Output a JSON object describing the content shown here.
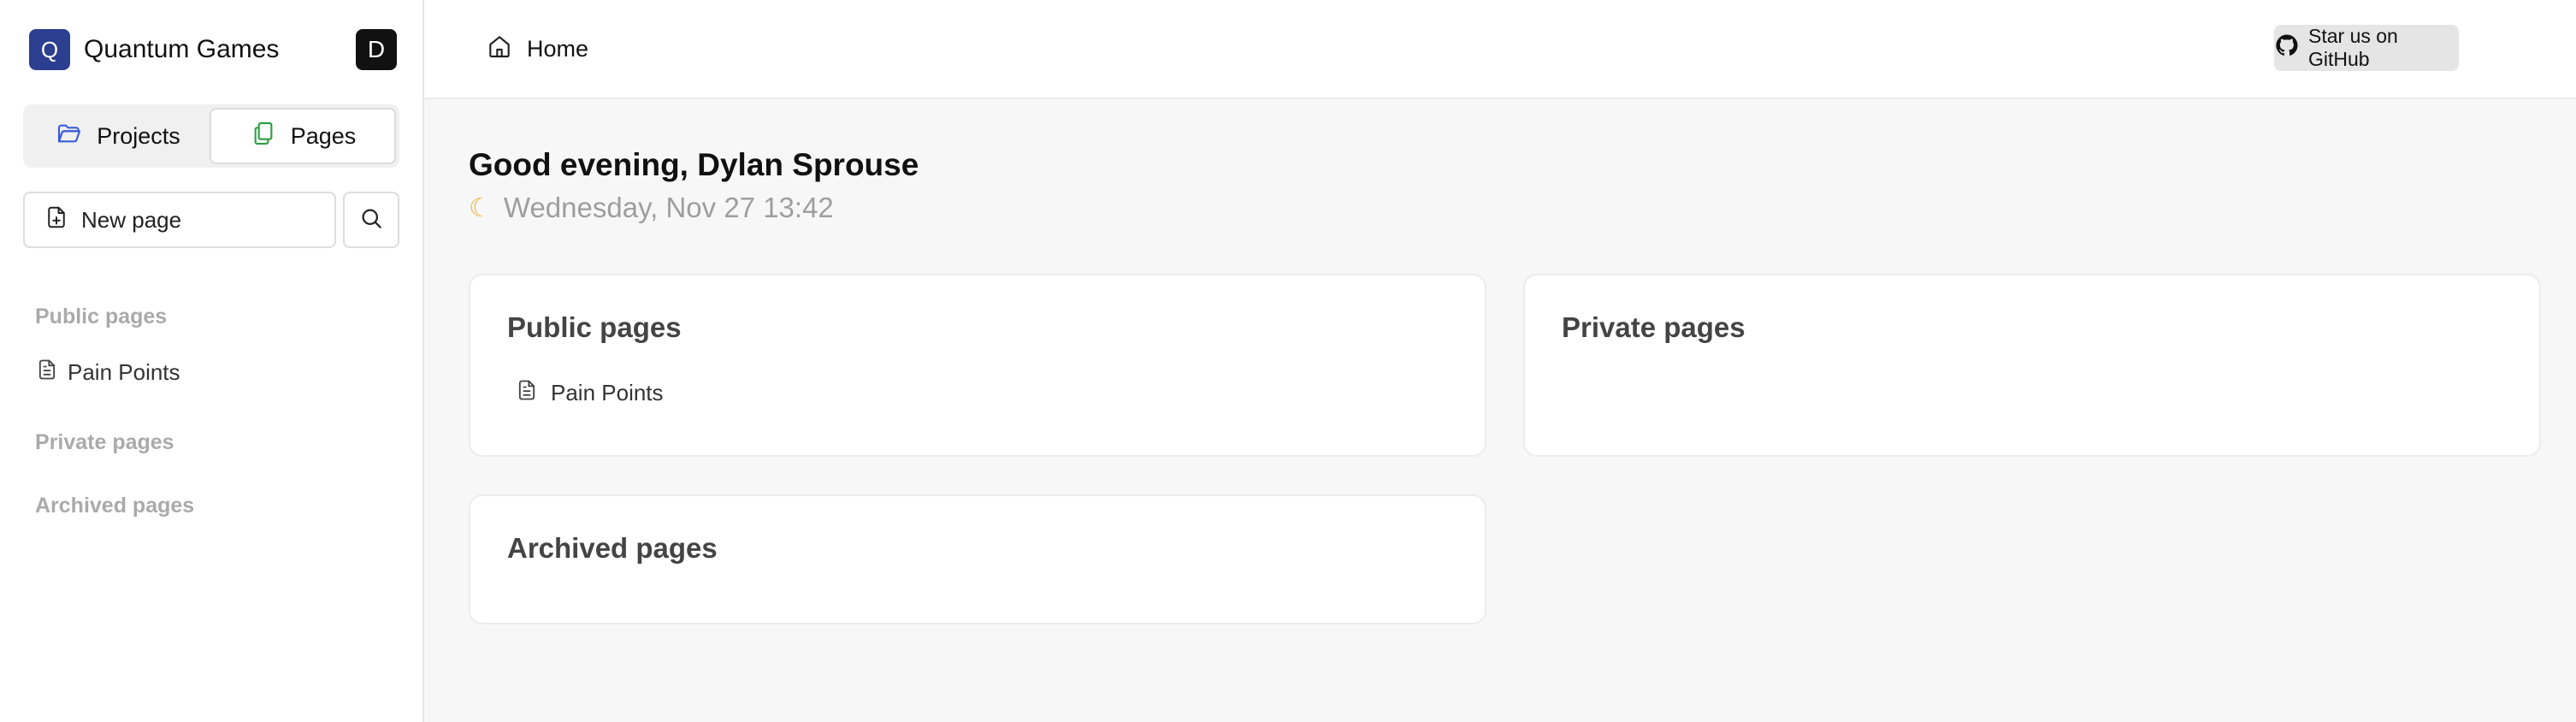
{
  "sidebar": {
    "workspace_initial": "Q",
    "workspace_name": "Quantum Games",
    "user_initial": "D",
    "tabs": [
      {
        "label": "Projects",
        "icon": "folder-icon"
      },
      {
        "label": "Pages",
        "icon": "pages-icon",
        "active": true
      }
    ],
    "new_page_label": "New page",
    "sections": {
      "public": "Public pages",
      "private": "Private pages",
      "archived": "Archived pages"
    },
    "public_items": [
      {
        "label": "Pain Points",
        "icon": "document-icon"
      }
    ]
  },
  "header": {
    "breadcrumb": "Home",
    "github_label": "Star us on GitHub"
  },
  "main": {
    "greeting": "Good evening, Dylan Sprouse",
    "date": "Wednesday, Nov 27 13:42",
    "cards": {
      "public_title": "Public pages",
      "public_items": [
        {
          "label": "Pain Points"
        }
      ],
      "private_title": "Private pages",
      "archived_title": "Archived pages"
    }
  },
  "colors": {
    "workspace_logo": "#2c3e8f",
    "projects_icon": "#3b5bdb",
    "pages_icon": "#2f9e44",
    "moon": "#e9b949"
  }
}
